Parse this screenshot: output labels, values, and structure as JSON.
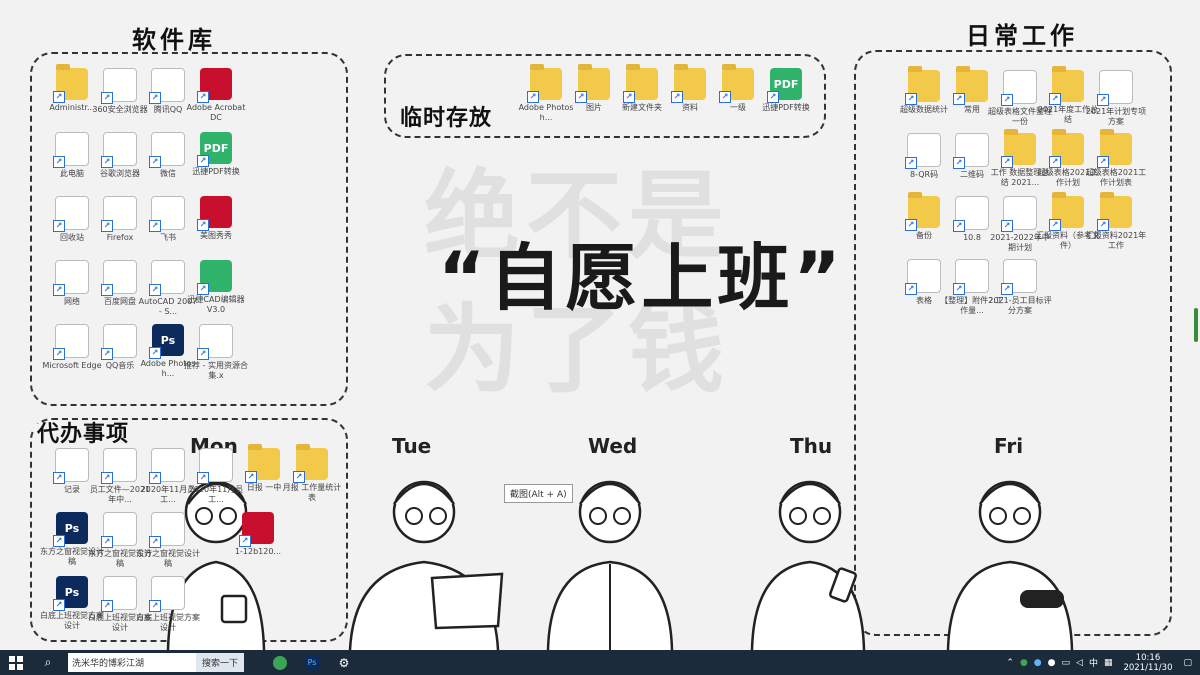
{
  "wallpaper": {
    "wm_line1": "绝不是",
    "wm_line2": "为了钱",
    "slogan": "“自愿上班”",
    "days": [
      "Mon",
      "Tue",
      "Wed",
      "Thu",
      "Fri"
    ]
  },
  "zones": {
    "software": "软件库",
    "temp": "临时存放",
    "daily": "日常工作",
    "todo": "代办事项"
  },
  "software_icons": [
    {
      "label": "Administr...",
      "icon": "user-folder-icon",
      "style": "folder"
    },
    {
      "label": "360安全浏览器",
      "icon": "browser-icon",
      "style": "doc"
    },
    {
      "label": "腾讯QQ",
      "icon": "qq-icon",
      "style": "doc"
    },
    {
      "label": "Adobe Acrobat DC",
      "icon": "acrobat-icon",
      "style": "red"
    },
    {
      "label": "此电脑",
      "icon": "computer-icon",
      "style": "docw"
    },
    {
      "label": "谷歌浏览器",
      "icon": "chrome-icon",
      "style": "doc"
    },
    {
      "label": "微信",
      "icon": "wechat-icon",
      "style": "doc"
    },
    {
      "label": "迅捷PDF转换",
      "icon": "pdf-icon",
      "style": "pdf"
    },
    {
      "label": "回收站",
      "icon": "recycle-bin-icon",
      "style": "docw"
    },
    {
      "label": "Firefox",
      "icon": "firefox-icon",
      "style": "doc"
    },
    {
      "label": "飞书",
      "icon": "feishu-icon",
      "style": "docw"
    },
    {
      "label": "美图秀秀",
      "icon": "meitu-icon",
      "style": "red"
    },
    {
      "label": "网络",
      "icon": "network-icon",
      "style": "docw"
    },
    {
      "label": "百度网盘",
      "icon": "baidu-pan-icon",
      "style": "docw"
    },
    {
      "label": "AutoCAD 2007 - S...",
      "icon": "autocad-icon",
      "style": "doc"
    },
    {
      "label": "迅捷CAD编辑器 V3.0",
      "icon": "cad-editor-icon",
      "style": "pdf"
    },
    {
      "label": "Microsoft Edge",
      "icon": "edge-icon",
      "style": "docw"
    },
    {
      "label": "QQ音乐",
      "icon": "qq-music-icon",
      "style": "doc"
    },
    {
      "label": "Adobe Photosh...",
      "icon": "photoshop-icon",
      "style": "ps"
    },
    {
      "label": "推荐 - 实用资源合集.x",
      "icon": "sheet-icon",
      "style": "doc"
    }
  ],
  "temp_icons": [
    {
      "label": "Adobe Photosh...",
      "icon": "folder-icon"
    },
    {
      "label": "图片",
      "icon": "folder-icon"
    },
    {
      "label": "新建文件夹",
      "icon": "folder-icon"
    },
    {
      "label": "资料",
      "icon": "folder-icon"
    },
    {
      "label": "一级",
      "icon": "archive-icon"
    },
    {
      "label": "迅捷PDF转换",
      "icon": "pdf-icon"
    }
  ],
  "daily_icons": [
    {
      "label": "超级数据统计",
      "icon": "folder-icon",
      "style": "folder"
    },
    {
      "label": "常用",
      "icon": "folder-icon",
      "style": "folder"
    },
    {
      "label": "超级表格文件整理一份",
      "icon": "sheet-icon",
      "style": "doc"
    },
    {
      "label": "2021年度工作总结",
      "icon": "folder-icon",
      "style": "folder"
    },
    {
      "label": "2021年计划专项方案",
      "icon": "sheet-icon",
      "style": "doc"
    },
    {
      "label": "8-QR码",
      "icon": "qr-icon",
      "style": "docw"
    },
    {
      "label": "二维码",
      "icon": "qr-icon",
      "style": "docw"
    },
    {
      "label": "工作 数据整理总结 2021...",
      "icon": "folder-icon",
      "style": "folder"
    },
    {
      "label": "超级表格2021工作计划",
      "icon": "folder-icon",
      "style": "folder"
    },
    {
      "label": "超级表格2021工作计划表",
      "icon": "folder-icon",
      "style": "folder"
    },
    {
      "label": "备份",
      "icon": "folder-icon",
      "style": "folder"
    },
    {
      "label": "10.8",
      "icon": "sheet-icon",
      "style": "doc"
    },
    {
      "label": "2021-2022年中期计划",
      "icon": "word-icon",
      "style": "docw"
    },
    {
      "label": "汇报资料（参考文件）",
      "icon": "folder-icon",
      "style": "folder"
    },
    {
      "label": "汇报资料2021年工作",
      "icon": "folder-icon",
      "style": "folder"
    },
    {
      "label": "表格",
      "icon": "sheet-icon",
      "style": "doc"
    },
    {
      "label": "【整理】附件2:工作量...",
      "icon": "sheet-icon",
      "style": "doc"
    },
    {
      "label": "2021-员工目标评分方案",
      "icon": "word-icon",
      "style": "docw"
    }
  ],
  "todo_icons": [
    {
      "label": "记录",
      "icon": "sheet-icon",
      "style": "doc"
    },
    {
      "label": "员工文件—2021年中...",
      "icon": "word-icon",
      "style": "docw"
    },
    {
      "label": "2020年11月员工...",
      "icon": "word-icon",
      "style": "docw"
    },
    {
      "label": "2020年11月员工...",
      "icon": "word-icon",
      "style": "docw"
    },
    {
      "label": "日报 一中",
      "icon": "folder-icon",
      "style": "folder"
    },
    {
      "label": "月报 工作量统计表",
      "icon": "folder-icon",
      "style": "folder"
    },
    {
      "label": "东方之窗视觉设计稿",
      "icon": "psd-icon",
      "style": "ps"
    },
    {
      "label": "东方之窗视觉设计稿",
      "icon": "image-icon",
      "style": "docw"
    },
    {
      "label": "东方之窗视觉设计稿",
      "icon": "image-icon",
      "style": "docw"
    },
    {
      "label": "1-12b120...",
      "icon": "image-icon",
      "style": "red"
    },
    {
      "label": "白底上班视觉方案设计",
      "icon": "psd-icon",
      "style": "ps"
    },
    {
      "label": "白底上班视觉方案设计",
      "icon": "image-icon",
      "style": "docw"
    },
    {
      "label": "白底上班视觉方案设计",
      "icon": "image-icon",
      "style": "docw"
    }
  ],
  "tooltip": "截图(Alt + A)",
  "taskbar": {
    "search_text": "洗米华的博彩江湖",
    "search_button": "搜索一下",
    "ime": "中",
    "time": "10:16",
    "date": "2021/11/30"
  }
}
